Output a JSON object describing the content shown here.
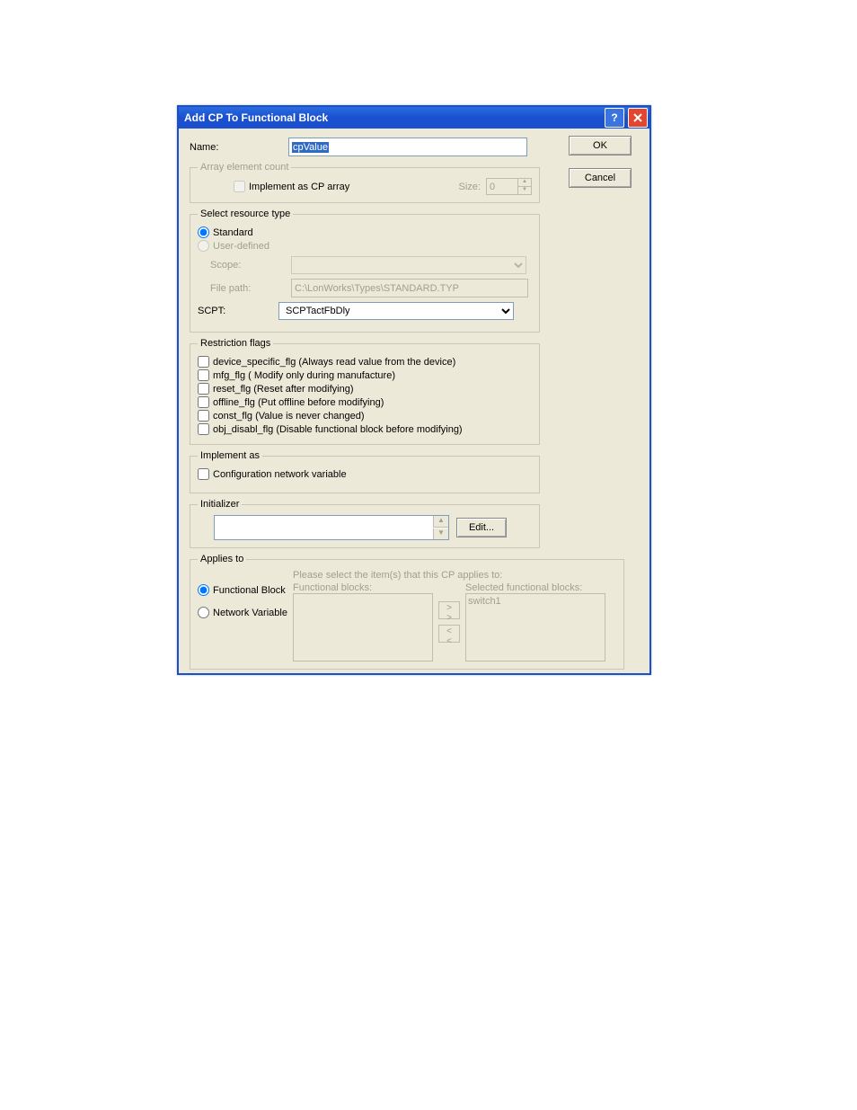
{
  "title": "Add CP To Functional Block",
  "buttons": {
    "ok": "OK",
    "cancel": "Cancel",
    "edit": "Edit..."
  },
  "name": {
    "label": "Name:",
    "value": "cpValue"
  },
  "array": {
    "legend": "Array element count",
    "impl_label": "Implement as CP array",
    "size_label": "Size:",
    "size_value": "0"
  },
  "resource": {
    "legend": "Select resource type",
    "standard": "Standard",
    "user_defined": "User-defined",
    "scope_label": "Scope:",
    "file_label": "File path:",
    "file_value": "C:\\LonWorks\\Types\\STANDARD.TYP",
    "scpt_label": "SCPT:",
    "scpt_value": "SCPTactFbDly"
  },
  "restriction": {
    "legend": "Restriction flags",
    "flags": [
      "device_specific_flg  (Always read value from the device)",
      "mfg_flg  ( Modify only during manufacture)",
      "reset_flg  (Reset after modifying)",
      "offline_flg  (Put offline before modifying)",
      "const_flg  (Value is never changed)",
      "obj_disabl_flg  (Disable functional block before modifying)"
    ]
  },
  "implement": {
    "legend": "Implement as",
    "cnv": "Configuration network variable"
  },
  "initializer": {
    "legend": "Initializer"
  },
  "applies": {
    "legend": "Applies to",
    "instruction": "Please select the item(s) that this CP applies to:",
    "fb": "Functional Block",
    "nv": "Network Variable",
    "left_header": "Functional blocks:",
    "right_header": "Selected functional blocks:",
    "selected_item": "switch1",
    "move_right": "> >",
    "move_left": "< <"
  }
}
